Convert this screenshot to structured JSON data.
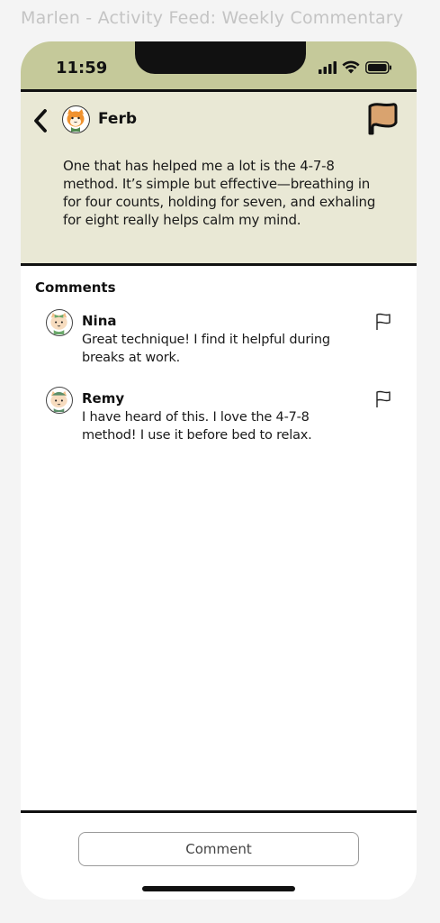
{
  "frame": {
    "title": "Marlen - Activity Feed: Weekly Commentary"
  },
  "status_bar": {
    "time": "11:59",
    "icons": [
      "signal-icon",
      "wifi-icon",
      "battery-icon"
    ],
    "color": "#c5c99a"
  },
  "post": {
    "author": "Ferb",
    "avatar": "cat-avatar-orange",
    "text": "One that has helped me a lot is the 4-7-8 method. It’s simple but effective—breathing in for four counts, holding for seven, and exhaling for eight really helps calm my mind.",
    "flag_color": "#d9a36f",
    "background": "#e9e8d5"
  },
  "comments_section": {
    "heading": "Comments",
    "items": [
      {
        "author": "Nina",
        "avatar": "cat-avatar-green-bow",
        "text": "Great technique! I find it helpful during breaks at work."
      },
      {
        "author": "Remy",
        "avatar": "cat-avatar-green-hat",
        "text": "I have heard of this. I love the 4-7-8 method! I use it before bed to relax."
      }
    ]
  },
  "footer": {
    "comment_button": "Comment"
  }
}
